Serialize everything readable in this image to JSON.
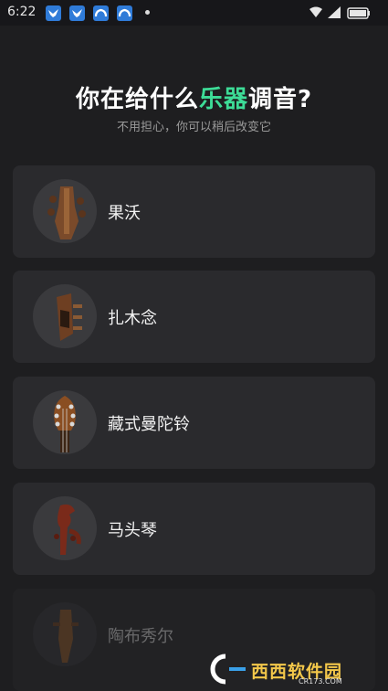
{
  "status_bar": {
    "time": "6:22",
    "notification_icons": [
      "bird-app-icon",
      "bird-app-icon",
      "cloud-app-icon",
      "cloud-app-icon"
    ],
    "system_icons": [
      "wifi-icon",
      "signal-icon",
      "battery-icon"
    ]
  },
  "header": {
    "title_prefix": "你在给什么",
    "title_accent": "乐器",
    "title_suffix": "调音?",
    "subtitle": "不用担心，你可以稍后改变它",
    "accent_color": "#3ddc97"
  },
  "instruments": [
    {
      "label": "果沃",
      "icon": "guowo-headstock-icon"
    },
    {
      "label": "扎木念",
      "icon": "zhamunian-headstock-icon"
    },
    {
      "label": "藏式曼陀铃",
      "icon": "tibetan-mandolin-headstock-icon"
    },
    {
      "label": "马头琴",
      "icon": "morin-khuur-headstock-icon"
    },
    {
      "label": "陶布秀尔",
      "icon": "tovshuur-headstock-icon"
    }
  ],
  "watermark": {
    "text": "西西软件园",
    "sub": "CR173.COM"
  }
}
